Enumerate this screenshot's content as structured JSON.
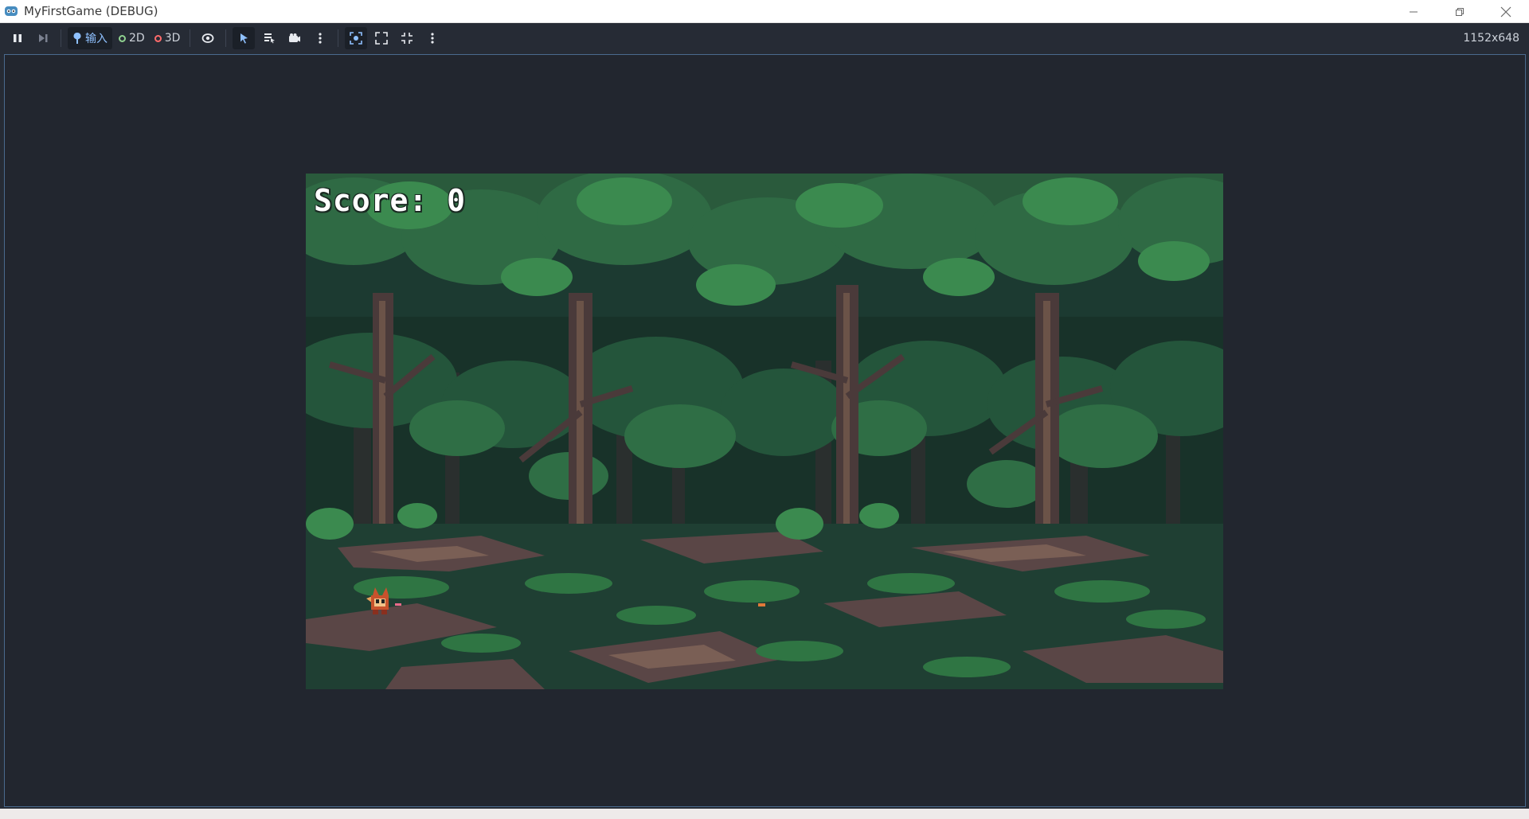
{
  "window": {
    "title": "MyFirstGame (DEBUG)",
    "icon": "godot-icon",
    "controls": [
      "minimize-icon",
      "restore-icon",
      "close-icon"
    ]
  },
  "toolbar": {
    "input_label": "输入",
    "mode_2d_label": "2D",
    "mode_3d_label": "3D",
    "resolution": "1152x648",
    "icons": [
      "pause-icon",
      "step-icon",
      "input-icon",
      "eye-icon",
      "select-arrow-icon",
      "list-select-icon",
      "camera-icon",
      "more-icon",
      "camera-override-icon",
      "fullscreen-icon",
      "expand-icon",
      "more-icon"
    ],
    "colors": {
      "active": "#8fc1ff",
      "dot_2d": "#8fd18f",
      "dot_3d": "#ff6b6b"
    }
  },
  "game": {
    "score_text": "Score: 0"
  }
}
